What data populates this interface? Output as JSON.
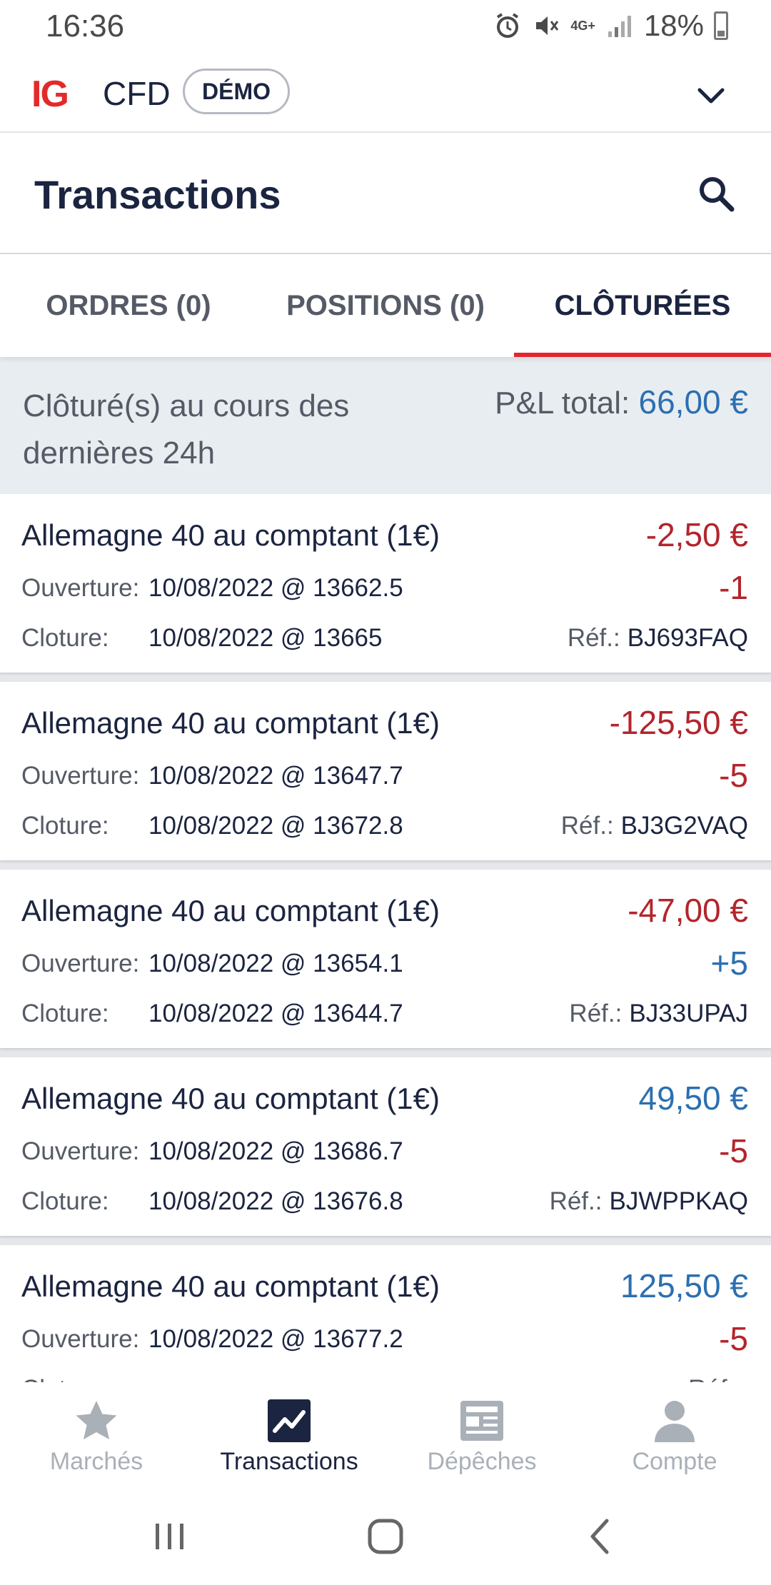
{
  "status_bar": {
    "time": "16:36",
    "network": "4G+",
    "battery": "18%"
  },
  "app_bar": {
    "logo": "IG",
    "product": "CFD",
    "mode_badge": "DÉMO"
  },
  "header": {
    "title": "Transactions"
  },
  "tabs": [
    {
      "label": "ORDRES (0)",
      "active": false
    },
    {
      "label": "POSITIONS (0)",
      "active": false
    },
    {
      "label": "CLÔTURÉES",
      "active": true
    }
  ],
  "summary": {
    "caption": "Clôturé(s) au cours des dernières 24h",
    "pl_label": "P&L total:",
    "pl_value": "66,00 €"
  },
  "transactions": [
    {
      "name": "Allemagne 40 au comptant (1€)",
      "pl": "-2,50 €",
      "quantity": "-1",
      "opening_label": "Ouverture:",
      "opening": "10/08/2022 @ 13662.5",
      "closing_label": "Cloture:",
      "closing": "10/08/2022 @ 13665",
      "ref_label": "Réf.:",
      "ref": "BJ693FAQ"
    },
    {
      "name": "Allemagne 40 au comptant (1€)",
      "pl": "-125,50 €",
      "quantity": "-5",
      "opening_label": "Ouverture:",
      "opening": "10/08/2022 @ 13647.7",
      "closing_label": "Cloture:",
      "closing": "10/08/2022 @ 13672.8",
      "ref_label": "Réf.:",
      "ref": "BJ3G2VAQ"
    },
    {
      "name": "Allemagne 40 au comptant (1€)",
      "pl": "-47,00 €",
      "quantity": "+5",
      "opening_label": "Ouverture:",
      "opening": "10/08/2022 @ 13654.1",
      "closing_label": "Cloture:",
      "closing": "10/08/2022 @ 13644.7",
      "ref_label": "Réf.:",
      "ref": "BJ33UPAJ"
    },
    {
      "name": "Allemagne 40 au comptant (1€)",
      "pl": "49,50 €",
      "quantity": "-5",
      "opening_label": "Ouverture:",
      "opening": "10/08/2022 @ 13686.7",
      "closing_label": "Cloture:",
      "closing": "10/08/2022 @ 13676.8",
      "ref_label": "Réf.:",
      "ref": "BJWPPKAQ"
    },
    {
      "name": "Allemagne 40 au comptant (1€)",
      "pl": "125,50 €",
      "quantity": "-5",
      "opening_label": "Ouverture:",
      "opening": "10/08/2022 @ 13677.2",
      "closing_label": "Cloture:",
      "closing": "",
      "ref_label": "Réf.:",
      "ref": ""
    }
  ],
  "bottom_nav": [
    {
      "label": "Marchés",
      "icon": "star-icon",
      "active": false
    },
    {
      "label": "Transactions",
      "icon": "chart-icon",
      "active": true
    },
    {
      "label": "Dépêches",
      "icon": "news-icon",
      "active": false
    },
    {
      "label": "Compte",
      "icon": "person-icon",
      "active": false
    }
  ],
  "colors": {
    "brand_red": "#e3262e",
    "positive_blue": "#2c6fb0",
    "negative_red": "#b3252c",
    "navy_text": "#1b2440"
  }
}
